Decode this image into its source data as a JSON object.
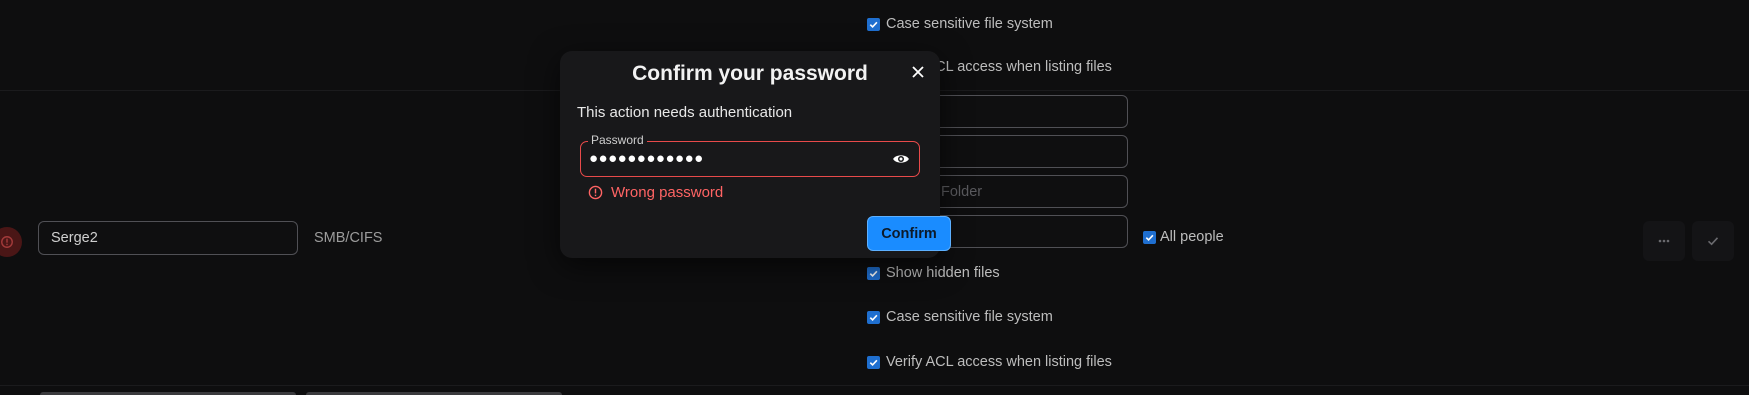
{
  "window_title": "Confirm your password",
  "background": {
    "top_checkboxes": [
      {
        "label": "Case sensitive file system",
        "checked": true
      },
      {
        "label": "Verify ACL access when listing files",
        "checked": true
      }
    ],
    "share_row": {
      "name_value": "Serge2",
      "protocol": "SMB/CIFS",
      "path_placeholder": "Folder",
      "permissions_label": "All people",
      "permissions_checked": true
    },
    "bottom_checkboxes": [
      {
        "label": "Show hidden files",
        "checked": true
      },
      {
        "label": "Case sensitive file system",
        "checked": true
      },
      {
        "label": "Verify ACL access when listing files",
        "checked": true
      }
    ]
  },
  "modal": {
    "title": "Confirm your password",
    "message": "This action needs authentication",
    "password_label": "Password",
    "password_value": "●●●●●●●●●●●●",
    "error_text": "Wrong password",
    "confirm_label": "Confirm"
  },
  "colors": {
    "accent": "#1a8cff",
    "error": "#ff6464",
    "checkbox": "#1f6fd0"
  },
  "icons": {
    "close": "close-icon",
    "eye": "eye-icon",
    "error": "error-circle-icon",
    "more": "more-horizontal-icon",
    "save": "check-icon"
  }
}
